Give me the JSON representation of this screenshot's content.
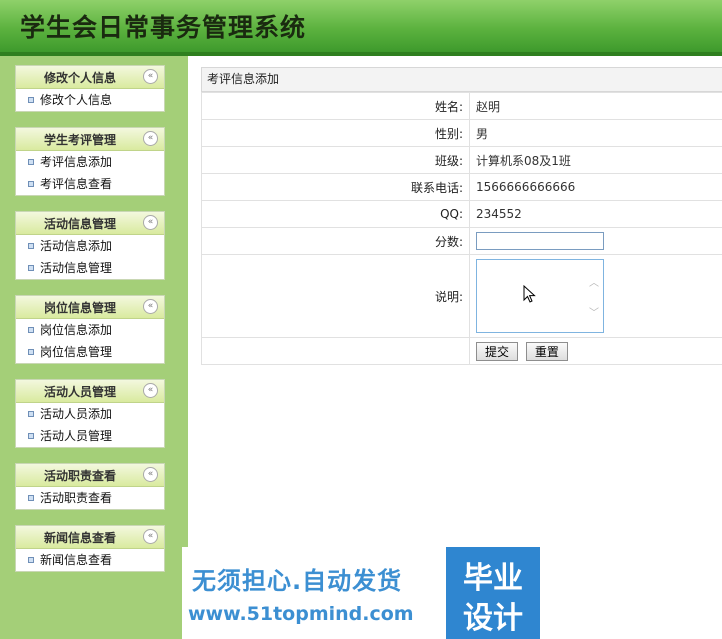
{
  "header": {
    "title": "学生会日常事务管理系统"
  },
  "sidebar": {
    "sections": [
      {
        "title": "修改个人信息",
        "items": [
          "修改个人信息"
        ]
      },
      {
        "title": "学生考评管理",
        "items": [
          "考评信息添加",
          "考评信息查看"
        ]
      },
      {
        "title": "活动信息管理",
        "items": [
          "活动信息添加",
          "活动信息管理"
        ]
      },
      {
        "title": "岗位信息管理",
        "items": [
          "岗位信息添加",
          "岗位信息管理"
        ]
      },
      {
        "title": "活动人员管理",
        "items": [
          "活动人员添加",
          "活动人员管理"
        ]
      },
      {
        "title": "活动职责查看",
        "items": [
          "活动职责查看"
        ]
      },
      {
        "title": "新闻信息查看",
        "items": [
          "新闻信息查看"
        ]
      }
    ],
    "collapse_glyph": "«"
  },
  "form": {
    "title": "考评信息添加",
    "name_label": "姓名:",
    "name_value": "赵明",
    "gender_label": "性别:",
    "gender_value": "男",
    "class_label": "班级:",
    "class_value": "计算机系08及1班",
    "phone_label": "联系电话:",
    "phone_value": "1566666666666",
    "qq_label": "QQ:",
    "qq_value": "234552",
    "score_label": "分数:",
    "score_value": "",
    "note_label": "说明:",
    "note_value": "",
    "submit_label": "提交",
    "reset_label": "重置"
  },
  "watermark": {
    "line1": "无须担心.自动发货",
    "line2": "www.51topmind.com",
    "right1": "毕业",
    "right2": "设计"
  },
  "colors": {
    "header_green": "#5cb23f",
    "sidebar_green": "#a4cf78",
    "watermark_blue": "#2f86d0"
  }
}
